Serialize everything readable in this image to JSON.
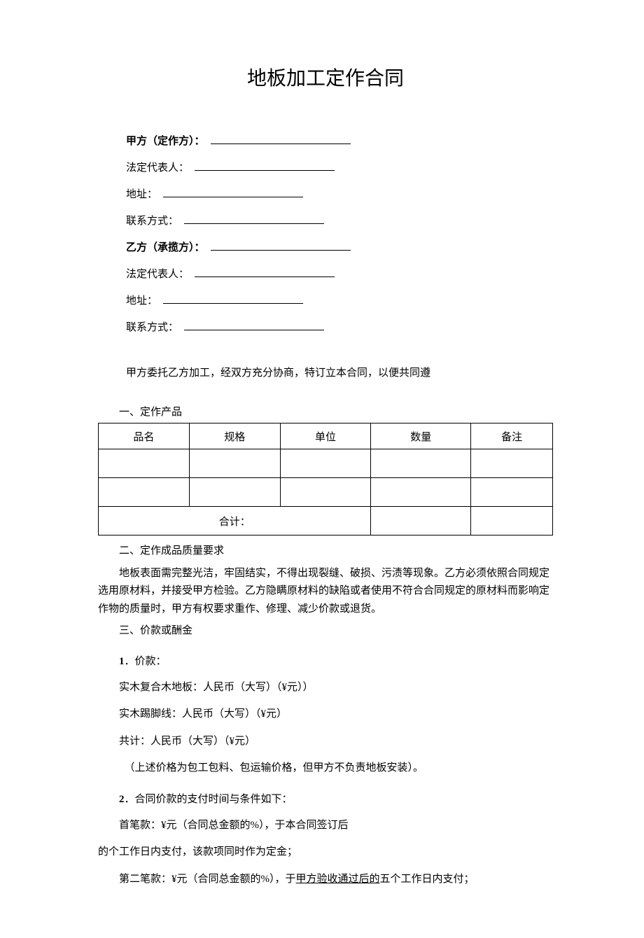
{
  "title": "地板加工定作合同",
  "partyA": {
    "label": "甲方（定作方）：",
    "legalRepLabel": "法定代表人：",
    "addressLabel": "地址：",
    "contactLabel": "联系方式："
  },
  "partyB": {
    "label": "乙方（承揽方）：",
    "legalRepLabel": "法定代表人：",
    "addressLabel": "地址：",
    "contactLabel": "联系方式："
  },
  "intro": "甲方委托乙方加工，经双方充分协商，特订立本合同，以便共同遵",
  "section1": {
    "head": "一、定作产品",
    "tableHeaders": {
      "name": "品名",
      "spec": "规格",
      "unit": "单位",
      "qty": "数量",
      "note": "备注"
    },
    "totalLabel": "合计："
  },
  "section2": {
    "head": "二、定作成品质量要求",
    "body": "地板表面需完整光洁，牢固结实，不得出现裂缝、破损、污渍等现象。乙方必须依照合同规定选用原材料，并接受甲方检验。乙方隐瞒原材料的缺陷或者使用不符合合同规定的原材料而影响定作物的质量时，甲方有权要求重作、修理、减少价款或退货。"
  },
  "section3": {
    "head": "三、价款或酬金",
    "item1": {
      "num": "1",
      "label": "．价款：",
      "lines": [
        "实木复合木地板：人民币（大写）（¥元））",
        "实木踢脚线：人民币（大写）（¥元）",
        "共计：人民币（大写）（¥元）",
        "（上述价格为包工包料、包运输价格，但甲方不负责地板安装）。"
      ]
    },
    "item2": {
      "num": "2",
      "label": "．合同价款的支付时间与条件如下：",
      "line1": "首笔款：¥元（合同总金额的%），于本合同签订后",
      "line2": "的个工作日内支付，该款项同时作为定金；",
      "line3a": "第二笔款：¥元（合同总金额的%），于",
      "line3u": "甲方验收通过后的",
      "line3b": "五个工作日内支付；"
    }
  }
}
